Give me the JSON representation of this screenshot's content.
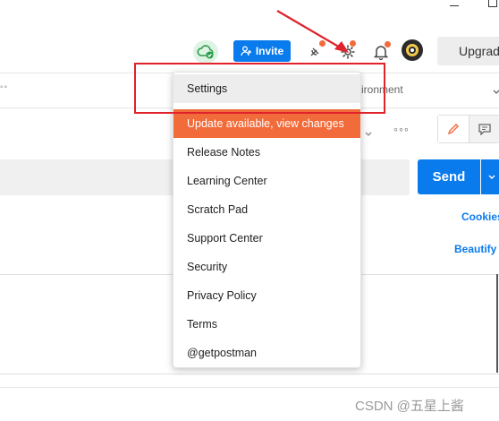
{
  "header": {
    "invite_label": "Invite",
    "upgrade_label": "Upgrad",
    "icons": [
      "sync-cloud-icon",
      "invite-user-icon",
      "satellite-icon",
      "settings-gear-icon",
      "bell-icon",
      "avatar"
    ],
    "status_colors": {
      "accent": "#097bed",
      "notification": "#f26b3a",
      "sync_ok": "#2a9d4a"
    }
  },
  "env_bar": {
    "tab_dots": "◦◦",
    "environment_label": "vironment"
  },
  "request_bar": {
    "more_label": "◦◦◦",
    "send_label": "Send"
  },
  "side_links": {
    "cookies": "Cookies",
    "beautify": "Beautify"
  },
  "settings_menu": {
    "items": [
      {
        "label": "Settings",
        "state": "hovered"
      },
      {
        "label": "Update available, view changes",
        "state": "highlighted"
      },
      {
        "label": "Release Notes"
      },
      {
        "label": "Learning Center"
      },
      {
        "label": "Scratch Pad"
      },
      {
        "label": "Support Center"
      },
      {
        "label": "Security"
      },
      {
        "label": "Privacy Policy"
      },
      {
        "label": "Terms"
      },
      {
        "label": "@getpostman"
      }
    ]
  },
  "watermark": "CSDN @五星上酱"
}
